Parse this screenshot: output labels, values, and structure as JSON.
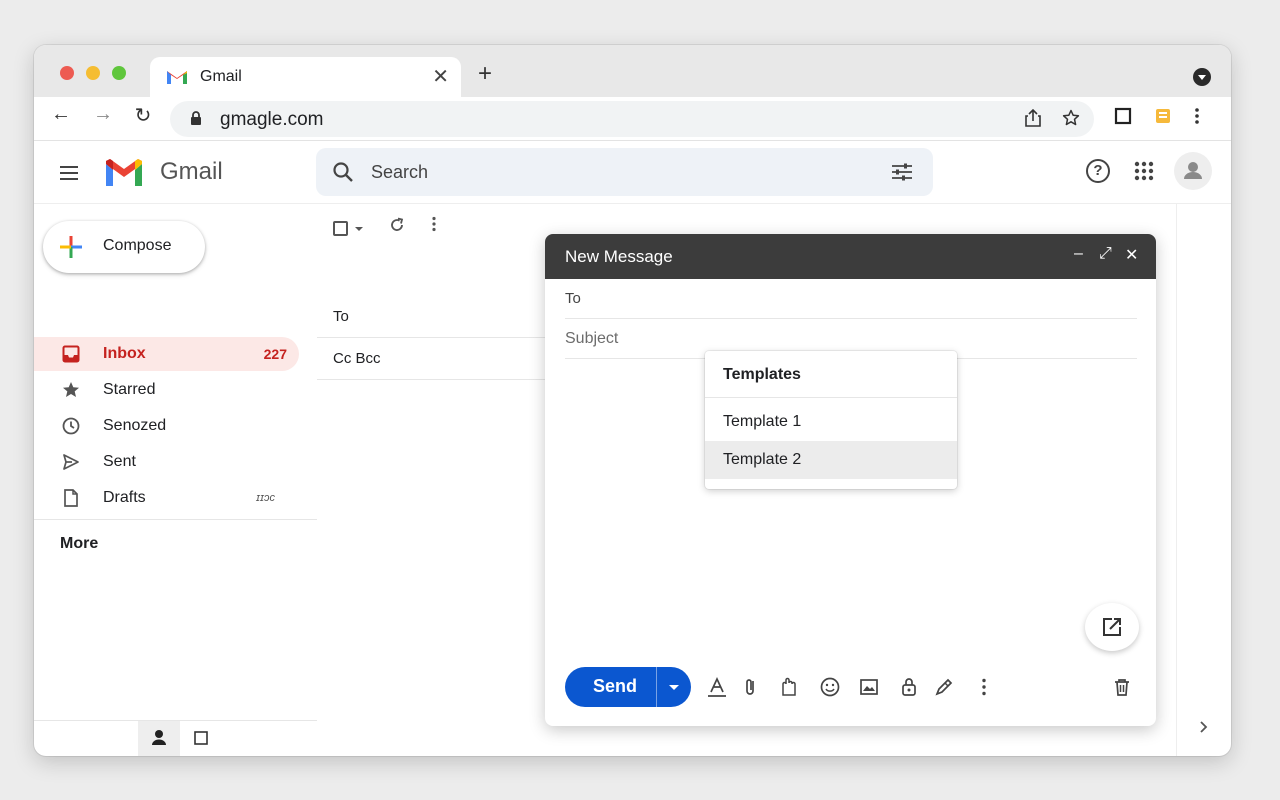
{
  "browser": {
    "tab_title": "Gmail",
    "tab_close": "✕",
    "new_tab": "+",
    "url": "gmagle.com",
    "back": "←",
    "forward": "→",
    "reload": "↻"
  },
  "header": {
    "app_name": "Gmail",
    "search_placeholder": "Search",
    "help_glyph": "?"
  },
  "sidebar": {
    "compose_label": "Compose",
    "items": [
      {
        "label": "Inbox",
        "count": "227",
        "icon": "inbox-icon",
        "active": true
      },
      {
        "label": "Starred",
        "icon": "star-icon"
      },
      {
        "label": "Senozed",
        "icon": "clock-icon"
      },
      {
        "label": "Sent",
        "icon": "send-icon"
      },
      {
        "label": "Drafts",
        "extra": "ɪɪɔc",
        "icon": "draft-icon"
      }
    ],
    "more_label": "More"
  },
  "list": {
    "rows": [
      "To",
      "Cc  Bcc"
    ]
  },
  "compose": {
    "title": "New Message",
    "minimize": "–",
    "expand": "⤢",
    "close": "✕",
    "to_label": "To",
    "subject_placeholder": "Subject",
    "send_label": "Send",
    "templates_menu": {
      "title": "Templates",
      "items": [
        "Template 1",
        "Template 2"
      ],
      "highlighted_index": 1
    }
  },
  "colors": {
    "accent_send": "#0b57d0",
    "inbox_active_bg": "#fce8e6",
    "inbox_text": "#c5221f",
    "compose_header": "#3c3c3c"
  }
}
